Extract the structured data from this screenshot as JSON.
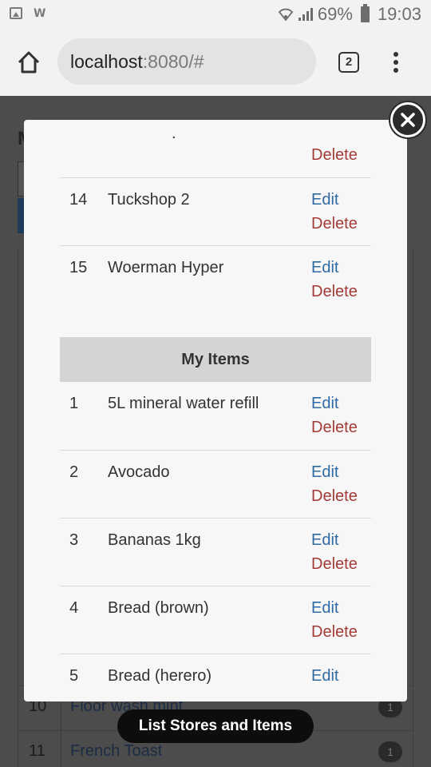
{
  "status_bar": {
    "battery_percent": "69%",
    "time": "19:03",
    "icons": [
      "image-icon",
      "w-app-icon",
      "wifi-icon",
      "signal-icon",
      "battery-icon"
    ]
  },
  "browser": {
    "url_host": "localhost",
    "url_rest": ":8080/#",
    "tab_count": "2"
  },
  "background_page": {
    "heading_letter": "M",
    "rows": [
      {
        "num": "10",
        "name": "Floor wash mint",
        "badge": "1"
      },
      {
        "num": "11",
        "name": "French Toast",
        "badge": "1"
      }
    ]
  },
  "modal": {
    "stores_tail": [
      {
        "idx": "",
        "label": ".",
        "edit": "",
        "delete": "Delete"
      },
      {
        "idx": "14",
        "label": "Tuckshop 2",
        "edit": "Edit",
        "delete": "Delete"
      },
      {
        "idx": "15",
        "label": "Woerman Hyper",
        "edit": "Edit",
        "delete": "Delete"
      }
    ],
    "items_header": "My Items",
    "items": [
      {
        "idx": "1",
        "label": "5L mineral water refill",
        "edit": "Edit",
        "delete": "Delete"
      },
      {
        "idx": "2",
        "label": "Avocado",
        "edit": "Edit",
        "delete": "Delete"
      },
      {
        "idx": "3",
        "label": "Bananas 1kg",
        "edit": "Edit",
        "delete": "Delete"
      },
      {
        "idx": "4",
        "label": "Bread (brown)",
        "edit": "Edit",
        "delete": "Delete"
      },
      {
        "idx": "5",
        "label": "Bread (herero)",
        "edit": "Edit",
        "delete": ""
      }
    ]
  },
  "footer_button": "List Stores and Items",
  "colors": {
    "edit_link": "#2f6aa3",
    "delete_link": "#a33b36",
    "section_header_bg": "#d4d4d4"
  }
}
